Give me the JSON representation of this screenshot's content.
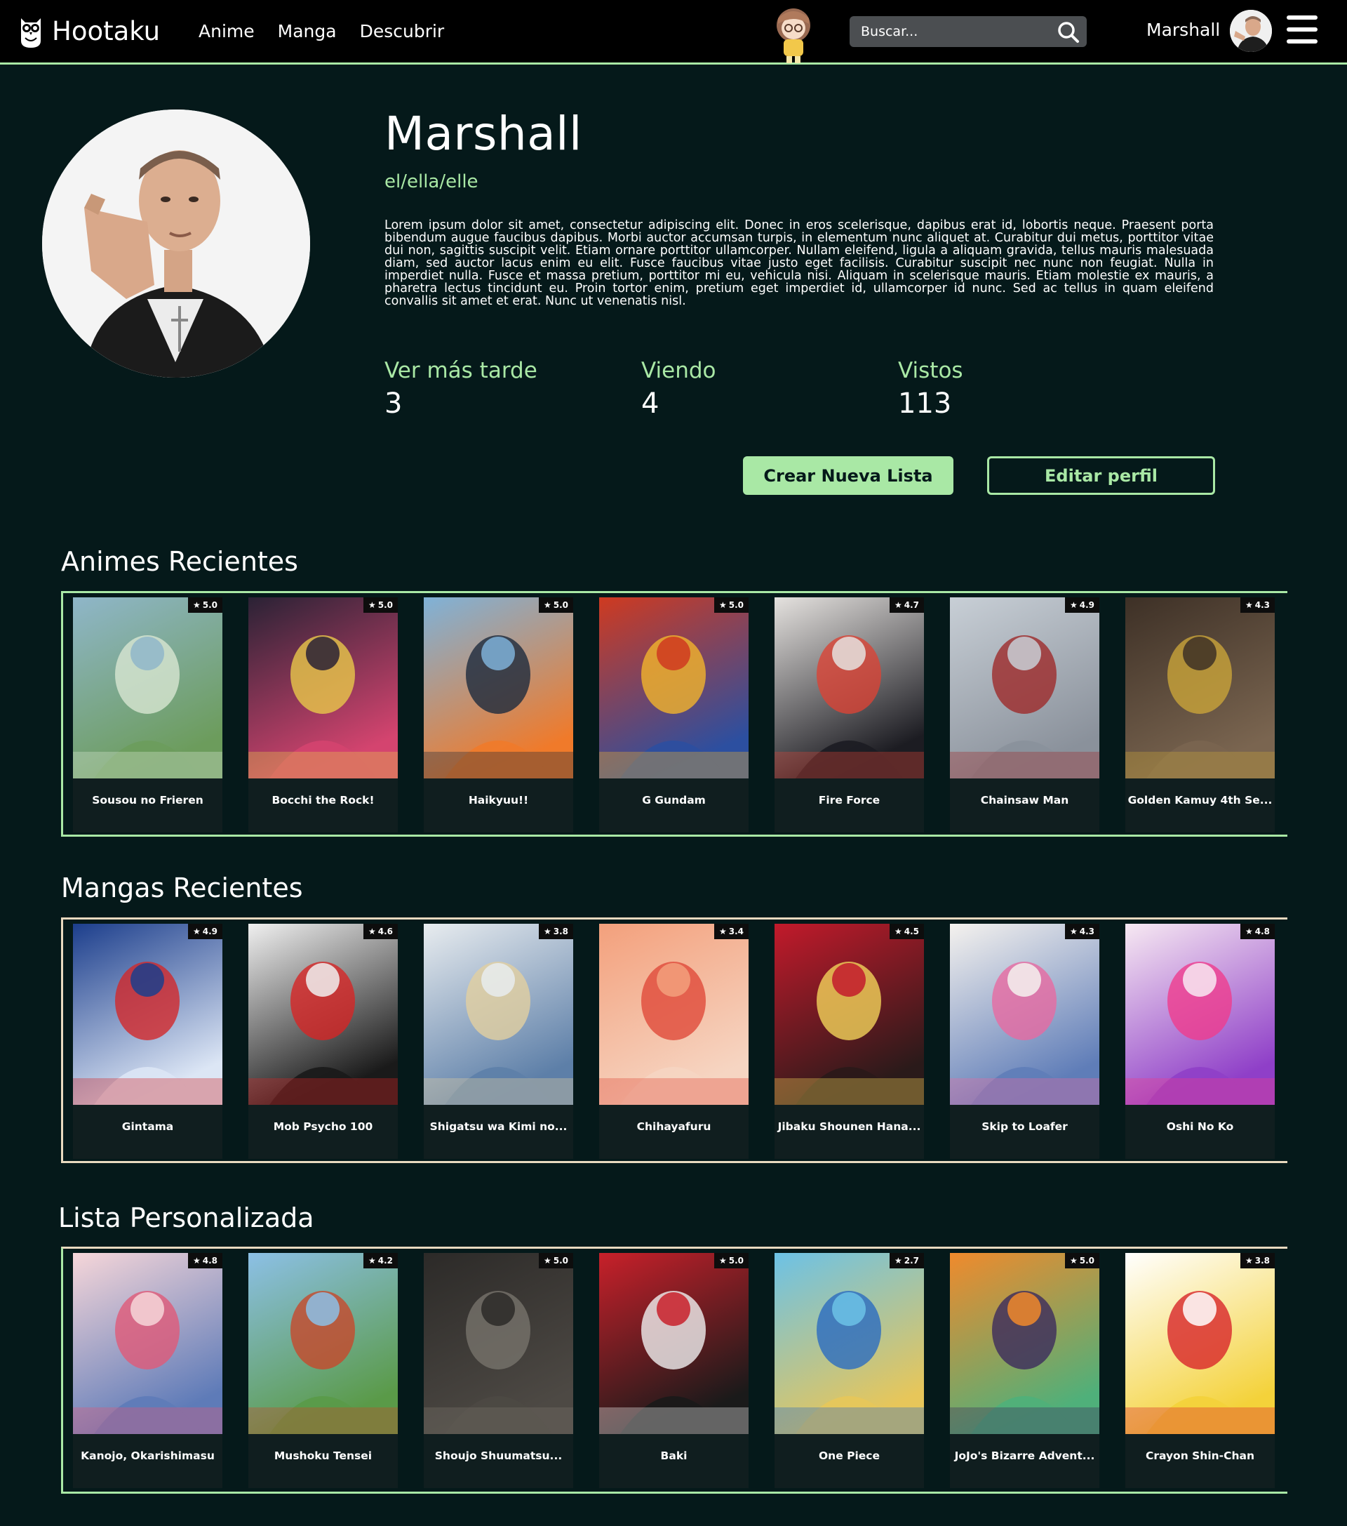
{
  "nav": {
    "brand": "Hootaku",
    "links": [
      "Anime",
      "Manga",
      "Descubrir"
    ],
    "search_placeholder": "Buscar...",
    "user": "Marshall"
  },
  "profile": {
    "name": "Marshall",
    "pronouns": "el/ella/elle",
    "bio": "Lorem ipsum dolor sit amet, consectetur adipiscing elit. Donec in eros scelerisque, dapibus erat id, lobortis neque. Praesent porta bibendum augue faucibus dapibus. Morbi auctor accumsan turpis, in elementum nunc aliquet at. Curabitur dui metus, porttitor vitae dui non, sagittis suscipit velit. Etiam ornare porttitor ullamcorper. Nullam eleifend, ligula a aliquam gravida, tellus mauris malesuada diam, sed auctor lacus enim eu elit. Fusce faucibus vitae justo eget facilisis. Curabitur suscipit nec nunc non feugiat. Nulla in imperdiet nulla. Fusce et massa pretium, porttitor mi eu, vehicula nisi. Aliquam in scelerisque mauris. Etiam molestie ex mauris, a pharetra lectus tincidunt eu. Proin tortor enim, pretium eget imperdiet id, ullamcorper id nunc. Sed ac tellus in quam eleifend convallis sit amet et erat. Nunc ut venenatis nisl.",
    "stats": [
      {
        "label": "Ver más tarde",
        "value": "3"
      },
      {
        "label": "Viendo",
        "value": "4"
      },
      {
        "label": "Vistos",
        "value": "113"
      }
    ],
    "create_list_label": "Crear Nueva Lista",
    "edit_profile_label": "Editar perfil"
  },
  "sections": [
    {
      "title": "Animes Recientes",
      "items": [
        {
          "title": "Sousou no Frieren",
          "rating": "5.0",
          "colors": [
            "#8fb6c9",
            "#6c9c5c",
            "#d8e6d2"
          ]
        },
        {
          "title": "Bocchi the Rock!",
          "rating": "5.0",
          "colors": [
            "#2a2235",
            "#d4446f",
            "#e9c84a"
          ]
        },
        {
          "title": "Haikyuu!!",
          "rating": "5.0",
          "colors": [
            "#7fb2d8",
            "#f07a2a",
            "#1d2b3d"
          ]
        },
        {
          "title": "G Gundam",
          "rating": "5.0",
          "colors": [
            "#cf3a20",
            "#2c4fa0",
            "#f2b42c"
          ]
        },
        {
          "title": "Fire Force",
          "rating": "4.7",
          "colors": [
            "#e5e2df",
            "#1c1c22",
            "#d94436"
          ]
        },
        {
          "title": "Chainsaw Man",
          "rating": "4.9",
          "colors": [
            "#c8cfd6",
            "#8a919b",
            "#9e2b2b"
          ]
        },
        {
          "title": "Golden Kamuy 4th Se...",
          "rating": "4.3",
          "colors": [
            "#3d3026",
            "#7a6550",
            "#c9a43a"
          ]
        }
      ]
    },
    {
      "title": "Mangas Recientes",
      "items": [
        {
          "title": "Gintama",
          "rating": "4.9",
          "colors": [
            "#1c3e8c",
            "#dce6f5",
            "#d2282a"
          ]
        },
        {
          "title": "Mob Psycho 100",
          "rating": "4.6",
          "colors": [
            "#f0f0f0",
            "#1a1a1a",
            "#d62626"
          ]
        },
        {
          "title": "Shigatsu wa Kimi no...",
          "rating": "3.8",
          "colors": [
            "#e8ecef",
            "#5d7fa8",
            "#e2cfa0"
          ]
        },
        {
          "title": "Chihayafuru",
          "rating": "3.4",
          "colors": [
            "#f3a07c",
            "#f6d5c2",
            "#e04a3a"
          ]
        },
        {
          "title": "Jibaku Shounen Hana...",
          "rating": "4.5",
          "colors": [
            "#c21a2b",
            "#2a1a1a",
            "#f3d35a"
          ]
        },
        {
          "title": "Skip to Loafer",
          "rating": "4.3",
          "colors": [
            "#f5f2ee",
            "#5f7db8",
            "#e76aa1"
          ]
        },
        {
          "title": "Oshi No Ko",
          "rating": "4.8",
          "colors": [
            "#f7e9f2",
            "#8f3fc8",
            "#ef3c8d"
          ]
        }
      ]
    },
    {
      "title": "Lista Personalizada",
      "items": [
        {
          "title": "Kanojo, Okarishimasu",
          "rating": "4.8",
          "colors": [
            "#f6d6d9",
            "#5e7bb8",
            "#e05a78"
          ]
        },
        {
          "title": "Mushoku Tensei",
          "rating": "4.2",
          "colors": [
            "#8cc0e6",
            "#5a9a48",
            "#c7482c"
          ]
        },
        {
          "title": "Shoujo Shuumatsu...",
          "rating": "5.0",
          "colors": [
            "#2c2a28",
            "#4d4944",
            "#77736b"
          ]
        },
        {
          "title": "Baki",
          "rating": "5.0",
          "colors": [
            "#c8202a",
            "#1a1a1a",
            "#f0f0f0"
          ]
        },
        {
          "title": "One Piece",
          "rating": "2.7",
          "colors": [
            "#6cc2e6",
            "#e7c65a",
            "#2a6bc0"
          ]
        },
        {
          "title": "JoJo's Bizarre Advent...",
          "rating": "5.0",
          "colors": [
            "#f08a2c",
            "#4fb07a",
            "#3c2a5c"
          ]
        },
        {
          "title": "Crayon Shin-Chan",
          "rating": "3.8",
          "colors": [
            "#ffffff",
            "#f4d23a",
            "#d8262a"
          ]
        }
      ]
    }
  ]
}
